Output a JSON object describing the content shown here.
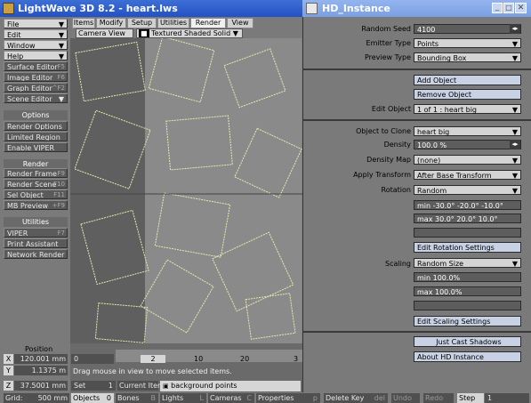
{
  "app": {
    "title": "LightWave 3D 8.2 - heart.lws"
  },
  "tabs": [
    "Items",
    "Modify",
    "Setup",
    "Utilities",
    "Render",
    "View"
  ],
  "viewport": {
    "view": "Camera View",
    "shading": "Textured Shaded Solid"
  },
  "left": {
    "menus": [
      "File",
      "Edit",
      "Window",
      "Help"
    ],
    "editors": [
      {
        "label": "Surface Editor",
        "key": "F5"
      },
      {
        "label": "Image Editor",
        "key": "F6"
      },
      {
        "label": "Graph Editor",
        "key": "^F2"
      },
      {
        "label": "Scene Editor",
        "key": ""
      }
    ],
    "options_head": "Options",
    "options": [
      "Render Options",
      "Limited Region",
      "Enable VIPER"
    ],
    "render_head": "Render",
    "render": [
      {
        "label": "Render Frame",
        "key": "F9"
      },
      {
        "label": "Render Scene",
        "key": "F10"
      },
      {
        "label": "Sel Object",
        "key": "F11"
      },
      {
        "label": "MB Preview",
        "key": "+F9"
      }
    ],
    "utilities_head": "Utilities",
    "utilities": [
      {
        "label": "VIPER",
        "key": "F7"
      },
      {
        "label": "Print Assistant",
        "key": ""
      },
      {
        "label": "Network Render",
        "key": ""
      }
    ]
  },
  "position": {
    "title": "Position",
    "x": "120.001 mm",
    "y": "1.1375 m",
    "z": "37.5001 mm",
    "grid_label": "Grid:",
    "grid": "500 mm"
  },
  "timeline": {
    "start": "0",
    "current": "2",
    "ticks": [
      "2",
      "10",
      "20",
      "3"
    ],
    "hint": "Drag mouse in view to move selected items.",
    "set_label": "Set",
    "set_val": "1",
    "current_item_label": "Current Item",
    "current_item": "background points"
  },
  "bottom": {
    "objects_label": "Objects",
    "objects_val": "0",
    "bones": "Bones",
    "bones_key": "B",
    "lights": "Lights",
    "lights_key": "L",
    "cameras": "Cameras",
    "cameras_key": "C",
    "properties": "Properties",
    "properties_key": "p",
    "delete": "Delete Key",
    "delete_key": "del",
    "undo": "Undo",
    "redo": "Redo",
    "step": "Step",
    "step_val": "1"
  },
  "hd": {
    "title": "HD_Instance",
    "random_seed_label": "Random Seed",
    "random_seed": "4100",
    "emitter_label": "Emitter Type",
    "emitter": "Points",
    "preview_label": "Preview Type",
    "preview": "Bounding Box",
    "add_object": "Add Object",
    "remove_object": "Remove Object",
    "edit_object_label": "Edit Object",
    "edit_object": "1 of 1 : heart big",
    "clone_label": "Object to Clone",
    "clone": "heart big",
    "density_label": "Density",
    "density": "100.0 %",
    "density_map_label": "Density Map",
    "density_map": "(none)",
    "apply_label": "Apply Transform",
    "apply": "After Base Transform",
    "rotation_label": "Rotation",
    "rotation": "Random",
    "rot_min": "min -30.0° -20.0° -10.0°",
    "rot_max": "max 30.0° 20.0° 10.0°",
    "edit_rotation": "Edit Rotation Settings",
    "scaling_label": "Scaling",
    "scaling": "Random Size",
    "scale_min": "min 100.0%",
    "scale_max": "max 100.0%",
    "edit_scaling": "Edit Scaling Settings",
    "cast_shadows": "Just Cast Shadows",
    "about": "About HD Instance"
  }
}
